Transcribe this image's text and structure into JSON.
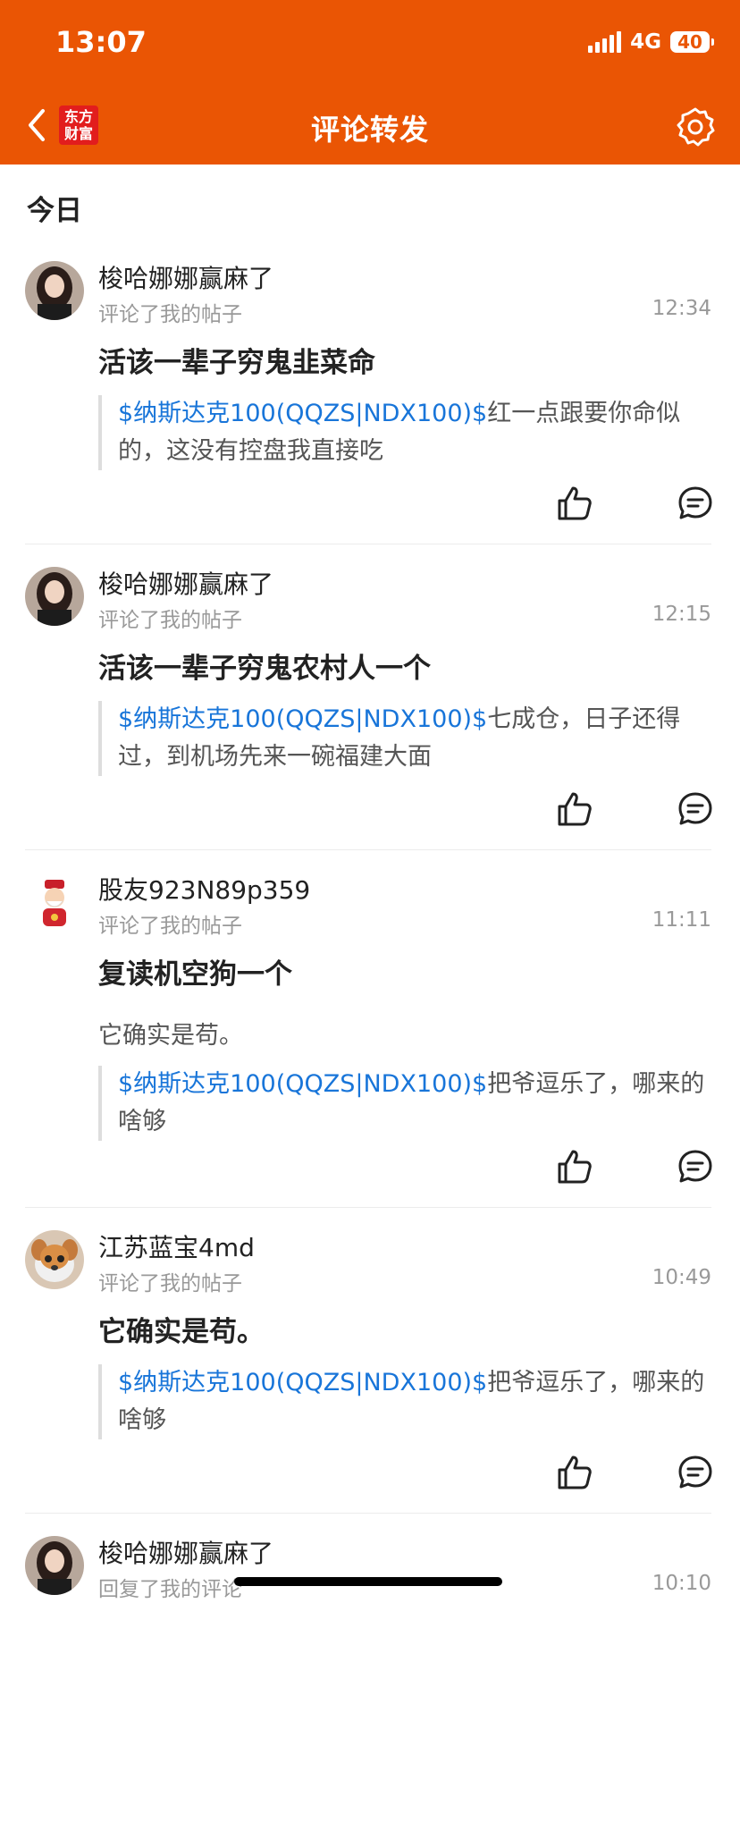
{
  "status": {
    "time": "13:07",
    "network": "4G",
    "battery": "40"
  },
  "header": {
    "logo_line1": "东方",
    "logo_line2": "财富",
    "title": "评论转发"
  },
  "section": {
    "title": "今日"
  },
  "colors": {
    "brand": "#EA5504",
    "link": "#1875D9"
  },
  "items": [
    {
      "user": "梭哈娜娜赢麻了",
      "action": "评论了我的帖子",
      "time": "12:34",
      "comment": "活该一辈子穷鬼韭菜命",
      "quote_tag": "$纳斯达克100(QQZS|NDX100)$",
      "quote_text": "红一点跟要你命似的，这没有控盘我直接吃",
      "avatar": "woman-avatar"
    },
    {
      "user": "梭哈娜娜赢麻了",
      "action": "评论了我的帖子",
      "time": "12:15",
      "comment": "活该一辈子穷鬼农村人一个",
      "quote_tag": "$纳斯达克100(QQZS|NDX100)$",
      "quote_text": "七成仓，日子还得过，到机场先来一碗福建大面",
      "avatar": "woman-avatar"
    },
    {
      "user": "股友923N89p359",
      "action": "评论了我的帖子",
      "time": "11:11",
      "comment": "复读机空狗一个",
      "subline": "它确实是苟。",
      "quote_tag": "$纳斯达克100(QQZS|NDX100)$",
      "quote_text": "把爷逗乐了，哪来的啥够",
      "avatar": "fortune-god-avatar"
    },
    {
      "user": "江苏蓝宝4md",
      "action": "评论了我的帖子",
      "time": "10:49",
      "comment": "它确实是苟。",
      "quote_tag": "$纳斯达克100(QQZS|NDX100)$",
      "quote_text": "把爷逗乐了，哪来的啥够",
      "avatar": "dog-avatar"
    },
    {
      "user": "梭哈娜娜赢麻了",
      "action": "回复了我的评论",
      "time": "10:10",
      "avatar": "woman-avatar"
    }
  ]
}
